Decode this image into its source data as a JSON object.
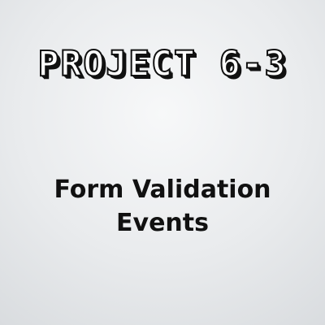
{
  "cover": {
    "project_label": "PROJECT 6-3",
    "subtitle_line1": "Form Validation",
    "subtitle_line2": "Events",
    "background_color": "#e9ebed",
    "text_color": "#111111"
  }
}
